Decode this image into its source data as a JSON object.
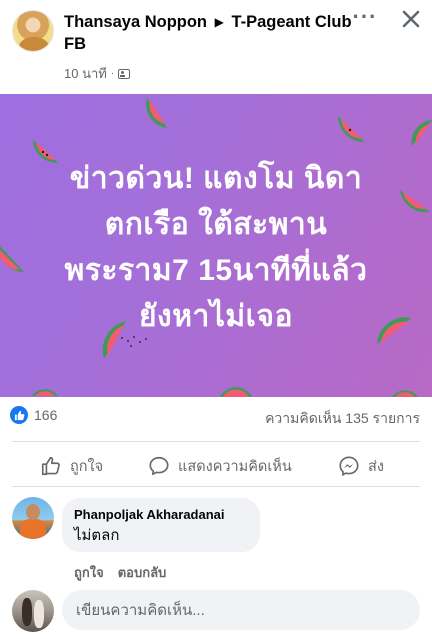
{
  "post": {
    "author": "Thansaya Noppon",
    "arrow": "▶",
    "group": "T-Pageant Club FB",
    "time": "10 นาที",
    "dot": "·",
    "privacy_icon": "group-icon"
  },
  "header_actions": {
    "more_label": "···",
    "close_label": "close"
  },
  "banner": {
    "lines": [
      "ข่าวด่วน! แตงโม นิดา",
      "ตกเรือ ใต้สะพาน",
      "พระราม7 15นาทีที่แล้ว",
      "ยังหาไม่เจอ"
    ],
    "background": "#a46fd8",
    "text_color": "#ffffff"
  },
  "stats": {
    "reaction_count": "166",
    "comments": "ความคิดเห็น 135 รายการ"
  },
  "actions": {
    "like": "ถูกใจ",
    "comment": "แสดงความคิดเห็น",
    "share": "ส่ง"
  },
  "comment": {
    "author": "Phanpoljak Akharadanai",
    "text": "ไม่ตลก",
    "like": "ถูกใจ",
    "reply": "ตอบกลับ"
  },
  "composer": {
    "placeholder": "เขียนความคิดเห็น..."
  },
  "colors": {
    "accent": "#1877f2",
    "secondary_text": "#65676b",
    "bubble_bg": "#f0f2f5"
  }
}
